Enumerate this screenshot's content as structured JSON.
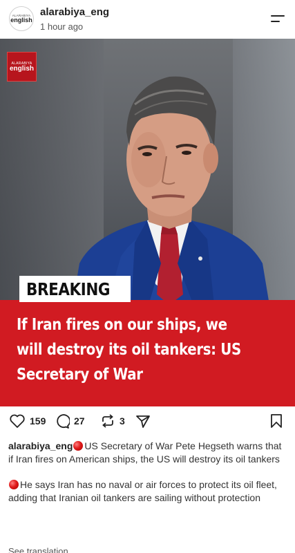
{
  "header": {
    "avatar_line1": "ALARABIYA",
    "avatar_line2": "english",
    "username": "alarabiya_eng",
    "time": "1 hour ago"
  },
  "post_image": {
    "logo_line1": "ALARABIYA",
    "logo_line2": "english",
    "breaking": "BREAKING",
    "headline_lines": [
      "If Iran fires on our ships, we",
      "will destroy its oil tankers: US",
      "Secretary of War"
    ],
    "band_color": "#d11b22"
  },
  "actions": {
    "likes": "159",
    "comments": "27",
    "reposts": "3"
  },
  "caption": {
    "username": "alarabiya_eng",
    "paragraph1": "US Secretary of War Pete Hegseth warns that if Iran fires on American ships, the US will destroy its oil tankers",
    "paragraph2": "He says Iran has no naval or air forces to protect its oil fleet, adding that Iranian oil tankers are sailing without protection",
    "see_translation": "See translation"
  },
  "icons": [
    "menu-icon",
    "heart-icon",
    "comment-icon",
    "repost-icon",
    "share-icon",
    "bookmark-icon",
    "red-circle-emoji"
  ]
}
